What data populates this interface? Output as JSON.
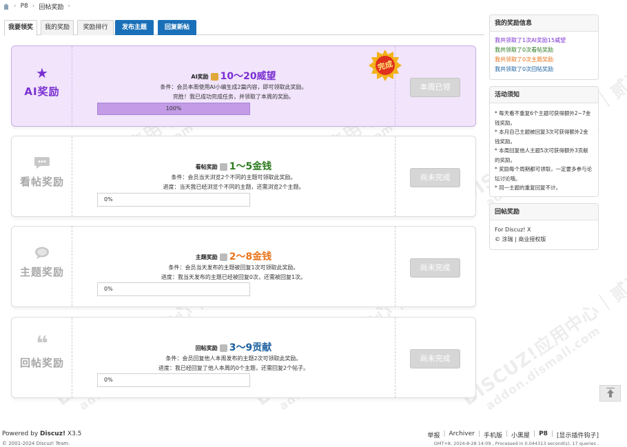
{
  "breadcrumb": {
    "items": [
      "P8",
      "回帖奖励"
    ]
  },
  "tabs": [
    {
      "label": "我要领奖",
      "active": true,
      "style": "normal"
    },
    {
      "label": "我的奖励",
      "active": false,
      "style": "normal"
    },
    {
      "label": "奖励排行",
      "active": false,
      "style": "normal"
    },
    {
      "label": "发布主题",
      "active": false,
      "style": "blue"
    },
    {
      "label": "回复新帖",
      "active": false,
      "style": "blue"
    }
  ],
  "tasks": [
    {
      "name": "AI奖励",
      "icon": "star-icon",
      "reward_label": "AI奖励",
      "reward_value": "10～20威望",
      "reward_color": "#7a2fd1",
      "cond1": "条件：会员本周使用AI小编生成2篇内容，即可领取此奖励。",
      "cond2": "完胜！我已成功完成任务，并领取了本周的奖励。",
      "progress_text": "100%",
      "progress": 100,
      "button": "本周已领",
      "badge": "完成"
    },
    {
      "name": "看帖奖励",
      "icon": "chat-bubble-icon",
      "reward_label": "看帖奖励",
      "reward_value": "1～5金钱",
      "reward_color": "#2b7a1e",
      "cond1": "条件：会员当天浏览2个不同的主题可领取此奖励。",
      "cond2": "进度：当天我已经浏览个不同的主题，还需浏览2个主题。",
      "progress_text": "0%",
      "progress": 0,
      "button": "尚未完成"
    },
    {
      "name": "主题奖励",
      "icon": "speech-icon",
      "reward_label": "主题奖励",
      "reward_value": "2～8金钱",
      "reward_color": "#e8731a",
      "cond1": "条件：会员当天发布的主题被回复1次可领取此奖励。",
      "cond2": "进度：我当天发布的主题已经被回复0次，还需被回复1次。",
      "progress_text": "0%",
      "progress": 0,
      "button": "尚未完成"
    },
    {
      "name": "回帖奖励",
      "icon": "quote-icon",
      "reward_label": "回帖奖励",
      "reward_value": "3～9贡献",
      "reward_color": "#1a5f9e",
      "cond1": "条件：会员回复他人本周发布的主题2次可领取此奖励。",
      "cond2": "进度：我已经回复了他人本周的0个主题，还需回复2个帖子。",
      "progress_text": "0%",
      "progress": 0,
      "button": "尚未完成"
    }
  ],
  "sidebar": {
    "my_rewards": {
      "title": "我的奖励信息",
      "lines": [
        {
          "text": "我共领取了1次AI奖励15威望",
          "color": "#7a2fd1"
        },
        {
          "text": "我共领取了0次看帖奖励",
          "color": "#2b7a1e"
        },
        {
          "text": "我共领取了0次主题奖励",
          "color": "#e8731a"
        },
        {
          "text": "我共领取了0次回帖奖励",
          "color": "#1a5f9e"
        }
      ]
    },
    "notice": {
      "title": "活动须知",
      "lines": [
        "* 每天看不重复6个主题可获得额外2~7金钱奖励。",
        "* 本月自己主题被回复3次可获得额外2金钱奖励。",
        "* 本周回复他人主题5次可获得额外3贡献的奖励。",
        "* 奖励每个周期都可领取，一定要多参与论坛讨论哦。",
        "* 同一主题的重复回复不计。"
      ]
    },
    "about": {
      "title": "回帖奖励",
      "line1": "For Discuz! X",
      "line2": "© 涂瑞 | 商业授权版"
    }
  },
  "footer": {
    "powered_prefix": "Powered by",
    "powered_brand": "Discuz!",
    "powered_version": "X3.5",
    "copyright": "© 2001-2024 Discuz! Team.",
    "links": [
      "举报",
      "Archiver",
      "手机版",
      "小黑屋",
      "P8",
      "[显示插件钩子]"
    ],
    "info": "GMT+8, 2024-8-28 14:09 , Processed in 0.044313 second(s), 17 queries ."
  },
  "watermark": {
    "line1": "DISCUZ!应用中心｜贰道",
    "line2": "addon.dismall.com"
  }
}
